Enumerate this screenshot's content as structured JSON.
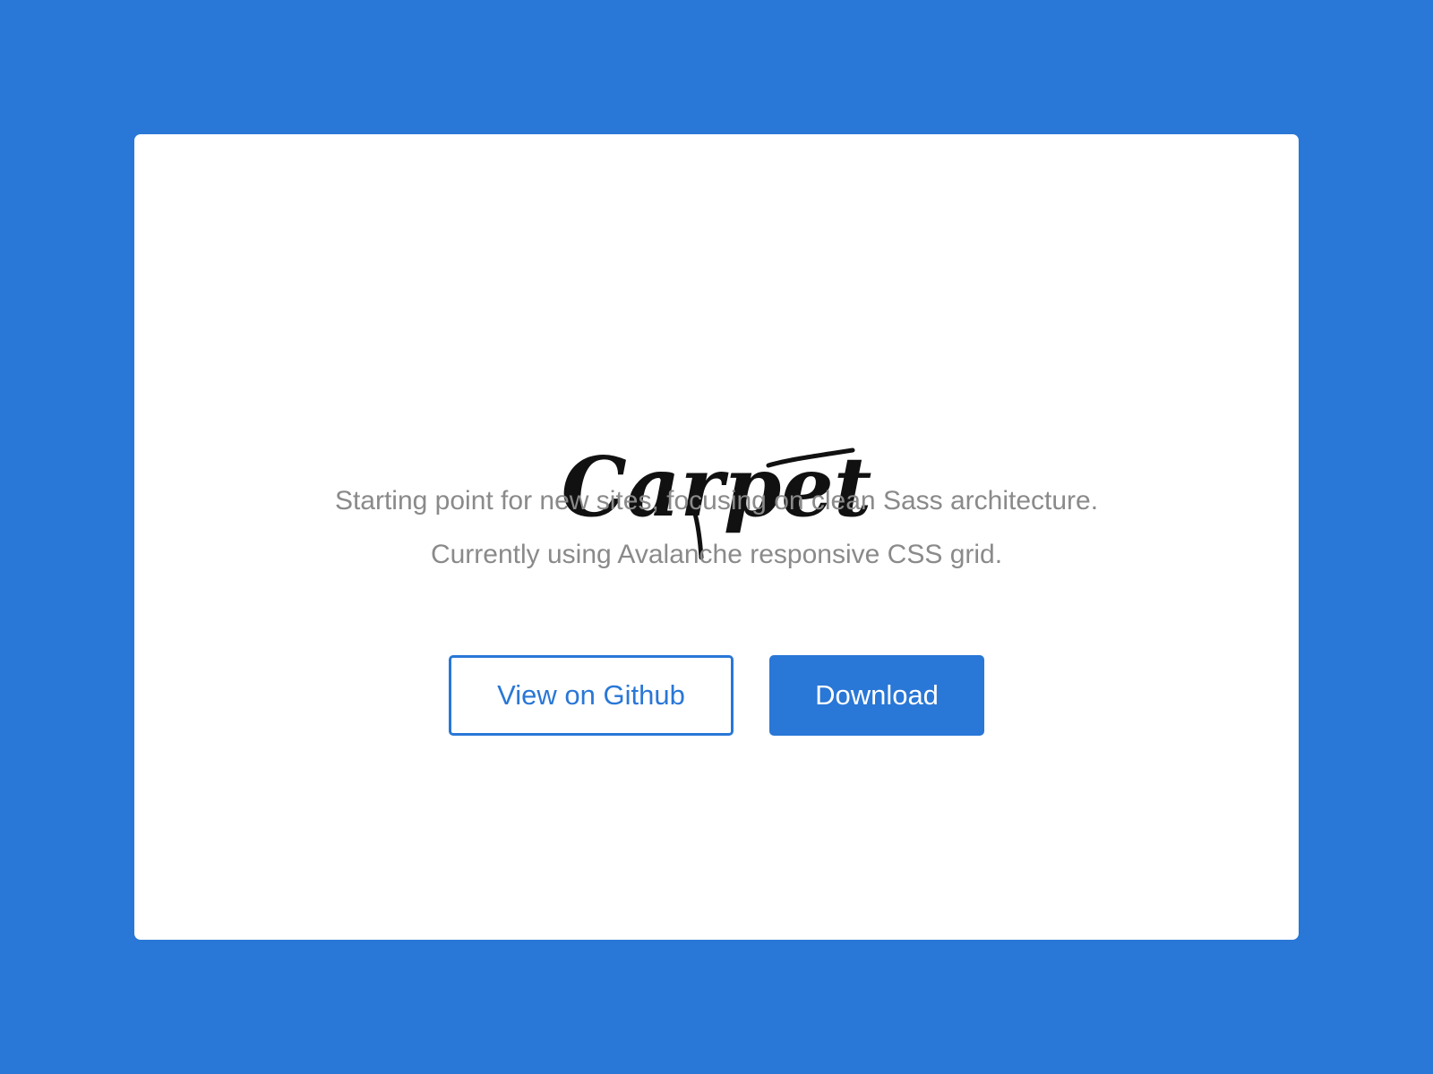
{
  "colors": {
    "background": "#2977d6",
    "card": "#ffffff",
    "accent": "#2977d6",
    "description_text": "#8a8a8a",
    "logo": "#111111"
  },
  "hero": {
    "logo_text": "Carpet",
    "description_lines": [
      "Starting point for new sites, focusing on clean Sass architecture.",
      "Currently using Avalanche responsive CSS grid."
    ]
  },
  "actions": {
    "github_label": "View on Github",
    "download_label": "Download"
  }
}
